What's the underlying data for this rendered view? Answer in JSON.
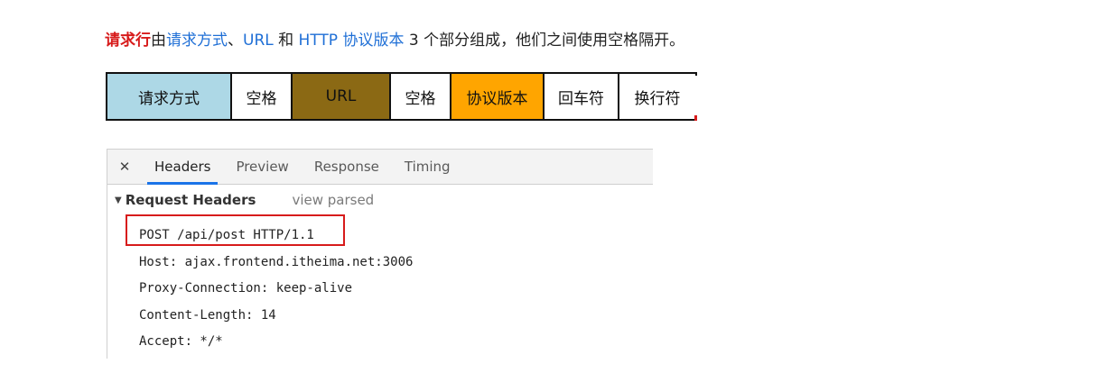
{
  "intro": {
    "term": "请求行",
    "t1": "由",
    "method": "请求方式",
    "sep": "、",
    "url": "URL",
    "and": " 和 ",
    "version": "HTTP 协议版本",
    "tail": " 3 个部分组成，他们之间使用空格隔开。"
  },
  "diagram": {
    "method": "请求方式",
    "space1": "空格",
    "url": "URL",
    "space2": "空格",
    "version": "协议版本",
    "cr": "回车符",
    "lf": "换行符"
  },
  "colors": {
    "method_bg": "#add8e6",
    "url_bg": "#8b6914",
    "version_bg": "#ffa500",
    "highlight": "#d71b1b",
    "link": "#1f6fd6",
    "active_tab": "#1a73e8"
  },
  "devtools": {
    "close_icon": "close-icon",
    "tabs": [
      "Headers",
      "Preview",
      "Response",
      "Timing"
    ],
    "active_tab": "Headers",
    "section_title": "Request Headers",
    "view_parsed": "view parsed",
    "lines": [
      "POST /api/post HTTP/1.1",
      "Host: ajax.frontend.itheima.net:3006",
      "Proxy-Connection: keep-alive",
      "Content-Length: 14",
      "Accept: */*"
    ]
  }
}
